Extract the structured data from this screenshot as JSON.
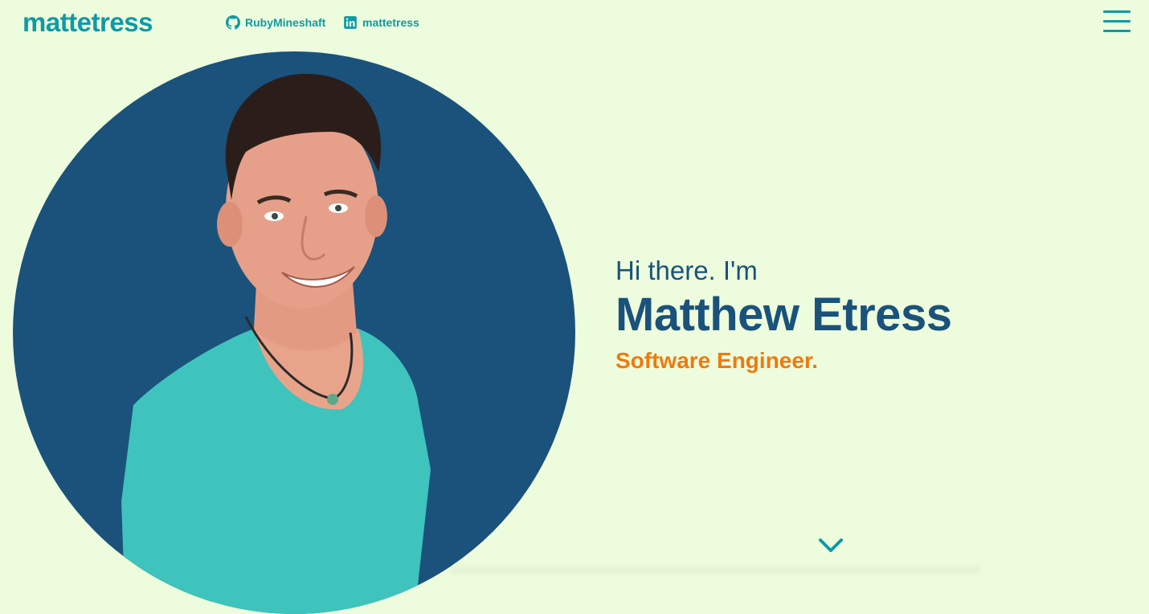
{
  "header": {
    "logo": "mattetress",
    "github_label": "RubyMineshaft",
    "linkedin_label": "mattetress",
    "menu_icon": "hamburger-menu-icon"
  },
  "hero": {
    "greeting": "Hi there. I'm",
    "name": "Matthew Etress",
    "role": "Software Engineer.",
    "scroll_icon": "chevron-down-icon"
  },
  "colors": {
    "background": "#edfcdd",
    "accent_teal": "#0e9aa6",
    "navy": "#1a527b",
    "orange": "#f07a0c",
    "shirt": "#3fc3bd"
  }
}
